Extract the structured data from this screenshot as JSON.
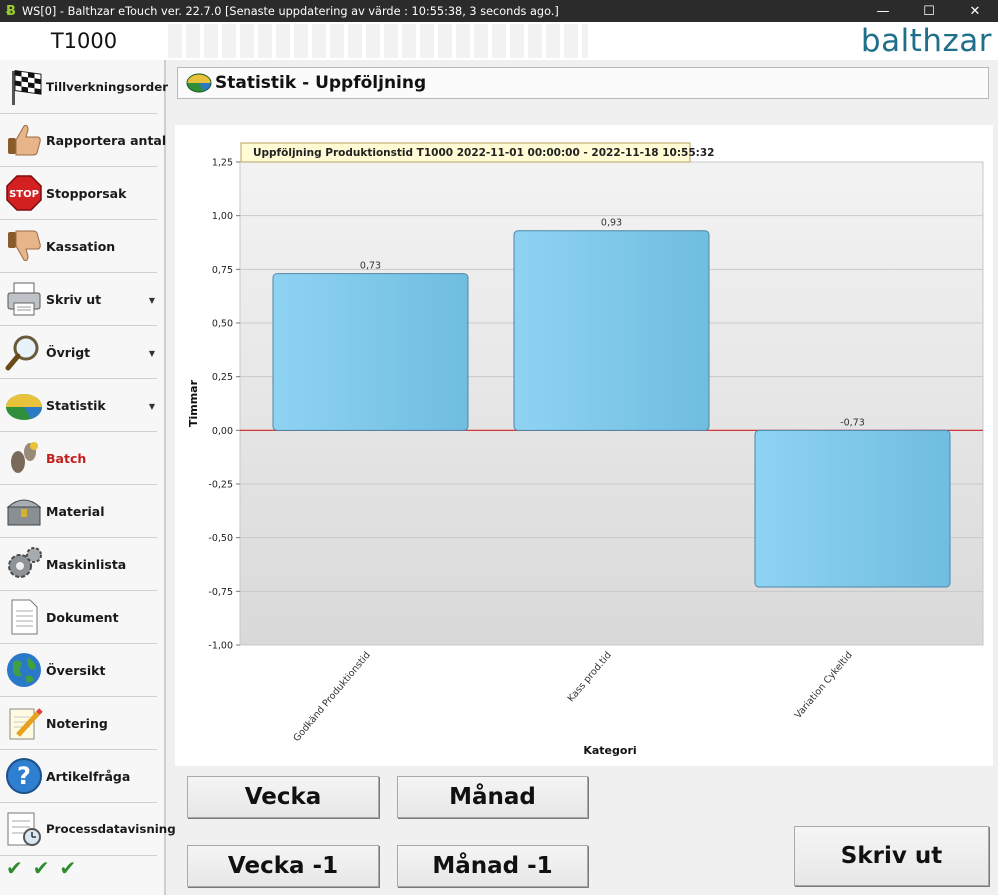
{
  "window": {
    "app_icon": "balthzar-b-icon",
    "title": "WS[0] - Balthzar eTouch ver. 22.7.0  [Senaste uppdatering av värde : 10:55:38, 3 seconds ago.]",
    "minimize": "—",
    "maximize": "☐",
    "close": "✕"
  },
  "header": {
    "machine": "T1000",
    "logo": "balthzar",
    "brand_color": "#1f6f8b"
  },
  "sidebar": {
    "items": [
      {
        "label": "Tillverkningsorder",
        "icon": "checkered-flag-icon"
      },
      {
        "label": "Rapportera antal",
        "icon": "thumbs-up-icon"
      },
      {
        "label": "Stopporsak",
        "icon": "stop-sign-icon",
        "icon_text": "STOP"
      },
      {
        "label": "Kassation",
        "icon": "thumbs-down-icon"
      },
      {
        "label": "Skriv ut",
        "icon": "printer-icon",
        "has_submenu": true
      },
      {
        "label": "Övrigt",
        "icon": "magnifier-icon",
        "has_submenu": true
      },
      {
        "label": "Statistik",
        "icon": "statistics-disc-icon",
        "has_submenu": true
      },
      {
        "label": "Batch",
        "icon": "footprints-icon",
        "highlight_color": "#c41f1f"
      },
      {
        "label": "Material",
        "icon": "treasure-chest-icon"
      },
      {
        "label": "Maskinlista",
        "icon": "gears-icon"
      },
      {
        "label": "Dokument",
        "icon": "document-icon"
      },
      {
        "label": "Översikt",
        "icon": "globe-icon"
      },
      {
        "label": "Notering",
        "icon": "note-pencil-icon"
      },
      {
        "label": "Artikelfråga",
        "icon": "question-icon"
      },
      {
        "label": "Processdatavisning",
        "icon": "process-data-icon"
      }
    ],
    "status_checks": [
      "✔",
      "✔",
      "✔"
    ]
  },
  "page": {
    "title": "Statistik - Uppföljning",
    "title_icon": "statistics-disc-icon"
  },
  "chart_data": {
    "type": "bar",
    "title": "Uppföljning Produktionstid T1000 2022-11-01 00:00:00 - 2022-11-18 10:55:32",
    "xlabel": "Kategori",
    "ylabel": "Timmar",
    "categories": [
      "Godkänd Produktionstid",
      "Kass prod.tid",
      "Variation Cykeltid"
    ],
    "values": [
      0.73,
      0.93,
      -0.73
    ],
    "value_labels": [
      "0,73",
      "0,93",
      "-0,73"
    ],
    "ylim": [
      -1.0,
      1.25
    ],
    "yticks": [
      1.25,
      1.0,
      0.75,
      0.5,
      0.25,
      0.0,
      -0.25,
      -0.5,
      -0.75,
      -1.0
    ],
    "ytick_labels": [
      "1,25",
      "1,00",
      "0,75",
      "0,50",
      "0,25",
      "0,00",
      "-0,25",
      "-0,50",
      "-0,75",
      "-1,00"
    ],
    "grid": true,
    "bar_color": "#87ceeb",
    "zero_line_color": "#cc2222"
  },
  "buttons": {
    "week": "Vecka",
    "month": "Månad",
    "week_prev": "Vecka -1",
    "month_prev": "Månad -1",
    "print": "Skriv ut"
  }
}
